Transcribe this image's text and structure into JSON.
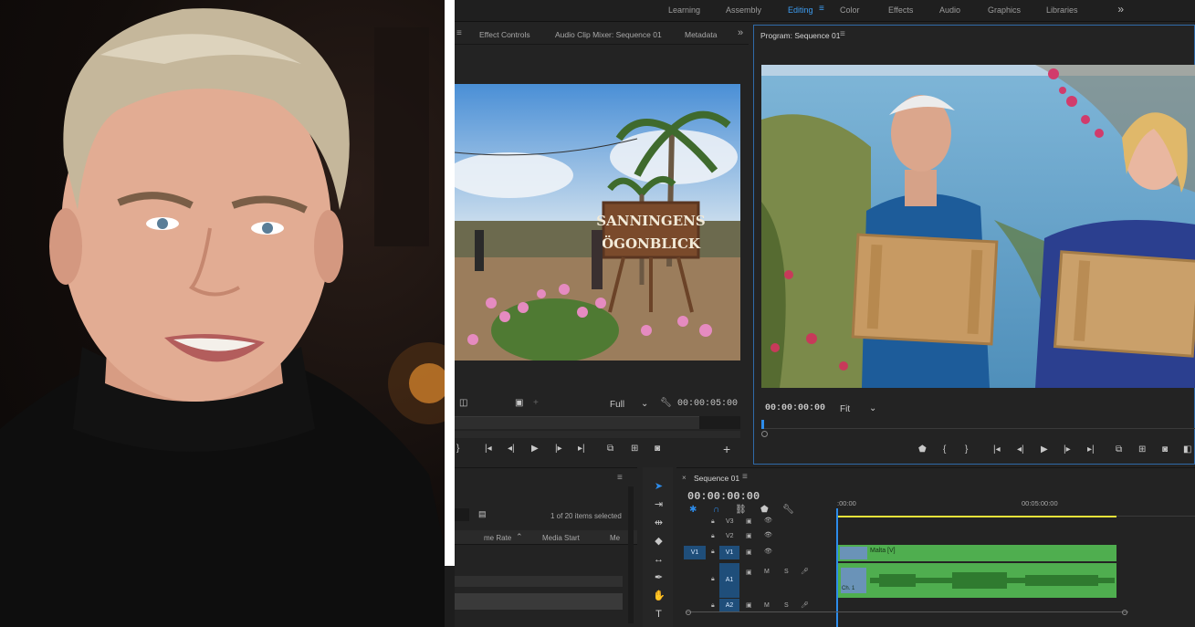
{
  "workspaces": [
    "Learning",
    "Assembly",
    "Editing",
    "Color",
    "Effects",
    "Audio",
    "Graphics",
    "Libraries"
  ],
  "workspace_more": "»",
  "source_panel": {
    "tabs": [
      "Effect Controls",
      "Audio Clip Mixer: Sequence 01",
      "Metadata"
    ],
    "tabs_more": "»",
    "sign_line1": "SANNINGENS",
    "sign_line2": "ÖGONBLICK",
    "zoom": "Full",
    "timecode": "00:00:05:00"
  },
  "program_panel": {
    "title": "Program: Sequence 01",
    "timecode": "00:00:00:00",
    "zoom": "Fit"
  },
  "project_panel": {
    "items_count": "1 of 20 items selected",
    "columns": [
      "me Rate",
      "Media Start",
      "Me"
    ]
  },
  "timeline": {
    "sequence_name": "Sequence 01",
    "timecode": "00:00:00:00",
    "ruler_start": ":00:00",
    "ruler_mid": "00:05:00:00",
    "tracks": {
      "v3": "V3",
      "v2": "V2",
      "v1": "V1",
      "v1_source": "V1",
      "a1": "A1",
      "a2": "A2",
      "m": "M",
      "s": "S"
    },
    "video_clip": "Malta [V]",
    "audio_channel": "Ch. 1"
  },
  "colors": {
    "accent_blue": "#2d8ceb",
    "clip_green": "#4fae4f",
    "playhead_yellow": "#e6e23a"
  }
}
